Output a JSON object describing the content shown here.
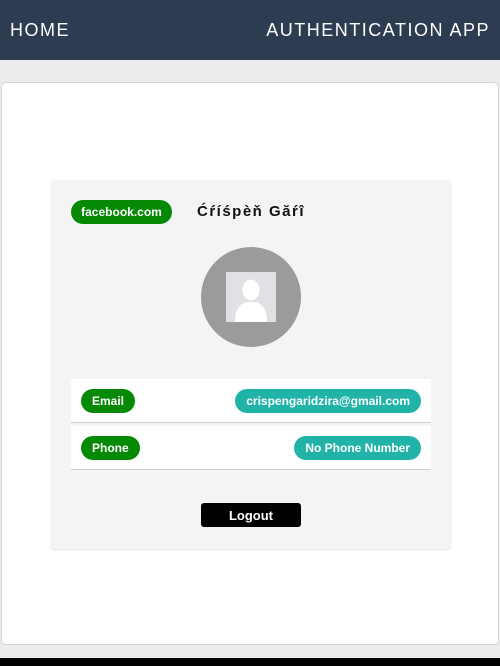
{
  "navbar": {
    "home_label": "HOME",
    "brand_label": "AUTHENTICATION APP"
  },
  "profile": {
    "provider": "facebook.com",
    "name": "Ćŕíśpèň Găŕî",
    "avatar_icon": "user-silhouette-icon",
    "rows": {
      "email": {
        "label": "Email",
        "value": "crispengaridzira@gmail.com"
      },
      "phone": {
        "label": "Phone",
        "value": "No Phone Number"
      }
    },
    "logout_label": "Logout"
  },
  "colors": {
    "navbar_bg": "#2d3c50",
    "label_green": "#068a06",
    "value_teal": "#22b3a8",
    "button_black": "#000000"
  }
}
